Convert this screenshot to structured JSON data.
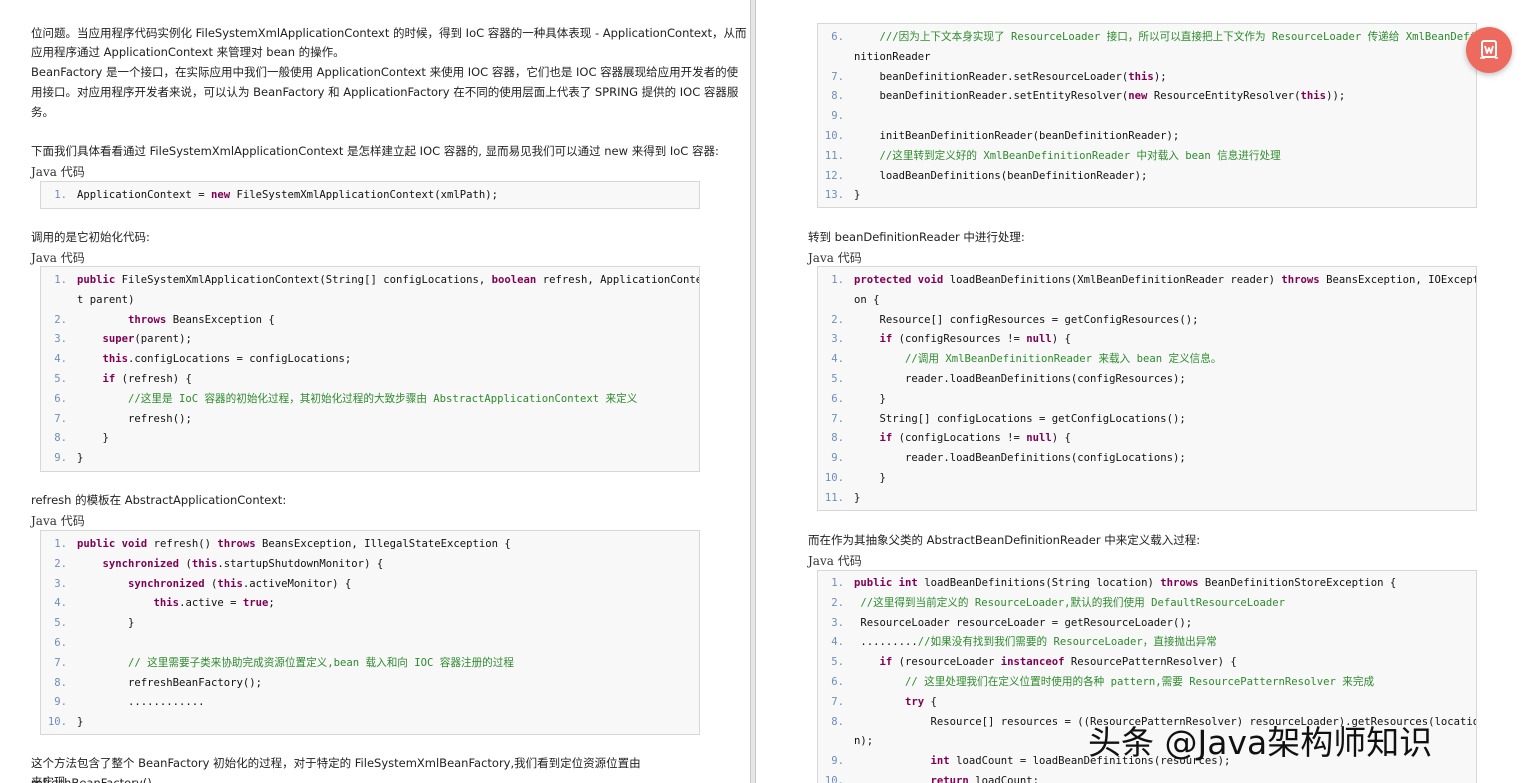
{
  "left": {
    "p1": "位问题。当应用程序代码实例化 FileSystemXmlApplicationContext 的时候，得到 IoC 容器的一种具体表现 - ApplicationContext，从而",
    "p2": "应用程序通过 ApplicationContext 来管理对 bean 的操作。",
    "p3": "BeanFactory 是一个接口，在实际应用中我们一般使用 ApplicationContext 来使用 IOC 容器，它们也是 IOC 容器展现给应用开发者的使",
    "p4": "用接口。对应用程序开发者来说，可以认为 BeanFactory 和 ApplicationFactory 在不同的使用层面上代表了 SPRING 提供的 IOC 容器服",
    "p5": "务。",
    "p6": "下面我们具体看看通过 FileSystemXmlApplicationContext 是怎样建立起 IOC 容器的, 显而易见我们可以通过 new 来得到 IoC 容器:",
    "label1": "Java 代码",
    "p7": "调用的是它初始化代码:",
    "label2": "Java 代码",
    "p8": "refresh 的模板在 AbstractApplicationContext:",
    "label3": "Java 代码",
    "p9": "这个方法包含了整个 BeanFactory 初始化的过程，对于特定的 FileSystemXmlBeanFactory,我们看到定位资源位置由 refreshBeanFactory()",
    "p10": "来实现"
  },
  "right": {
    "p1": "转到 beanDefinitionReader 中进行处理:",
    "label1": "Java 代码",
    "p2": "而在作为其抽象父类的 AbstractBeanDefinitionReader 中来定义载入过程:",
    "label2": "Java 代码"
  },
  "code_blocks": [
    {
      "lines": [
        {
          "n": "1.",
          "t": "ApplicationContext = new FileSystemXmlApplicationContext(xmlPath);"
        }
      ]
    },
    {
      "lines": [
        {
          "n": "1.",
          "t": "public FileSystemXmlApplicationContext(String[] configLocations, boolean refresh, ApplicationContex"
        },
        {
          "n": "",
          "t": "t parent)"
        },
        {
          "n": "2.",
          "t": "        throws BeansException {"
        },
        {
          "n": "3.",
          "t": "    super(parent);"
        },
        {
          "n": "4.",
          "t": "    this.configLocations = configLocations;"
        },
        {
          "n": "5.",
          "t": "    if (refresh) {"
        },
        {
          "n": "6.",
          "t": "        //这里是 IoC 容器的初始化过程，其初始化过程的大致步骤由 AbstractApplicationContext 来定义"
        },
        {
          "n": "7.",
          "t": "        refresh();"
        },
        {
          "n": "8.",
          "t": "    }"
        },
        {
          "n": "9.",
          "t": "}"
        }
      ]
    },
    {
      "lines": [
        {
          "n": "1.",
          "t": "public void refresh() throws BeansException, IllegalStateException {"
        },
        {
          "n": "2.",
          "t": "    synchronized (this.startupShutdownMonitor) {"
        },
        {
          "n": "3.",
          "t": "        synchronized (this.activeMonitor) {"
        },
        {
          "n": "4.",
          "t": "            this.active = true;"
        },
        {
          "n": "5.",
          "t": "        }"
        },
        {
          "n": "6.",
          "t": ""
        },
        {
          "n": "7.",
          "t": "        // 这里需要子类来协助完成资源位置定义,bean 载入和向 IOC 容器注册的过程"
        },
        {
          "n": "8.",
          "t": "        refreshBeanFactory();"
        },
        {
          "n": "9.",
          "t": "        ............"
        },
        {
          "n": "10.",
          "t": "}"
        }
      ]
    },
    {
      "lines": [
        {
          "n": "6.",
          "t": "    ///因为上下文本身实现了 ResourceLoader 接口，所以可以直接把上下文作为 ResourceLoader 传递给 XmlBeanDefi"
        },
        {
          "n": "",
          "t": "nitionReader"
        },
        {
          "n": "7.",
          "t": "    beanDefinitionReader.setResourceLoader(this);"
        },
        {
          "n": "8.",
          "t": "    beanDefinitionReader.setEntityResolver(new ResourceEntityResolver(this));"
        },
        {
          "n": "9.",
          "t": ""
        },
        {
          "n": "10.",
          "t": "    initBeanDefinitionReader(beanDefinitionReader);"
        },
        {
          "n": "11.",
          "t": "    //这里转到定义好的 XmlBeanDefinitionReader 中对载入 bean 信息进行处理"
        },
        {
          "n": "12.",
          "t": "    loadBeanDefinitions(beanDefinitionReader);"
        },
        {
          "n": "13.",
          "t": "}"
        }
      ]
    },
    {
      "lines": [
        {
          "n": "1.",
          "t": "protected void loadBeanDefinitions(XmlBeanDefinitionReader reader) throws BeansException, IOExcepti"
        },
        {
          "n": "",
          "t": "on {"
        },
        {
          "n": "2.",
          "t": "    Resource[] configResources = getConfigResources();"
        },
        {
          "n": "3.",
          "t": "    if (configResources != null) {"
        },
        {
          "n": "4.",
          "t": "        //调用 XmlBeanDefinitionReader 来载入 bean 定义信息。"
        },
        {
          "n": "5.",
          "t": "        reader.loadBeanDefinitions(configResources);"
        },
        {
          "n": "6.",
          "t": "    }"
        },
        {
          "n": "7.",
          "t": "    String[] configLocations = getConfigLocations();"
        },
        {
          "n": "8.",
          "t": "    if (configLocations != null) {"
        },
        {
          "n": "9.",
          "t": "        reader.loadBeanDefinitions(configLocations);"
        },
        {
          "n": "10.",
          "t": "    }"
        },
        {
          "n": "11.",
          "t": "}"
        }
      ]
    },
    {
      "lines": [
        {
          "n": "1.",
          "t": "public int loadBeanDefinitions(String location) throws BeanDefinitionStoreException {"
        },
        {
          "n": "2.",
          "t": " //这里得到当前定义的 ResourceLoader,默认的我们使用 DefaultResourceLoader"
        },
        {
          "n": "3.",
          "t": " ResourceLoader resourceLoader = getResourceLoader();"
        },
        {
          "n": "4.",
          "t": " .........//如果没有找到我们需要的 ResourceLoader，直接抛出异常"
        },
        {
          "n": "5.",
          "t": "    if (resourceLoader instanceof ResourcePatternResolver) {"
        },
        {
          "n": "6.",
          "t": "        // 这里处理我们在定义位置时使用的各种 pattern,需要 ResourcePatternResolver 来完成"
        },
        {
          "n": "7.",
          "t": "        try {"
        },
        {
          "n": "8.",
          "t": "            Resource[] resources = ((ResourcePatternResolver) resourceLoader).getResources(locatio"
        },
        {
          "n": "",
          "t": "n);"
        },
        {
          "n": "9.",
          "t": "            int loadCount = loadBeanDefinitions(resources);"
        },
        {
          "n": "10.",
          "t": "            return loadCount;"
        }
      ]
    }
  ],
  "watermark": "头条 @Java架构师知识",
  "colors": {
    "keyword": "#7f0055",
    "comment": "#2e8b2e",
    "line_number": "#6f8fb8",
    "code_bg": "#f8f8f8",
    "fab": "#ee6a5e"
  },
  "icons": {
    "fab": "translate-window-icon"
  }
}
